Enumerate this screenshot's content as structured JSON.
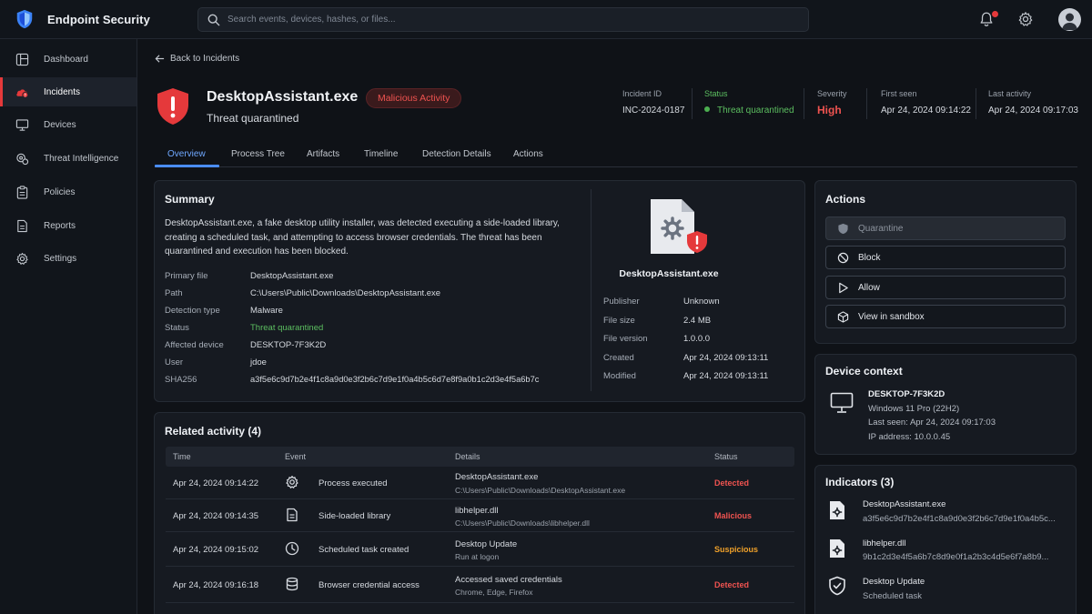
{
  "app": {
    "name": "Endpoint Security",
    "search_placeholder": "Search events, devices, hashes, or files..."
  },
  "sidebar": {
    "items": [
      {
        "label": "Dashboard",
        "icon": "dashboard-icon"
      },
      {
        "label": "Incidents",
        "icon": "incidents-icon",
        "active": true
      },
      {
        "label": "Devices",
        "icon": "monitor-icon"
      },
      {
        "label": "Threat Intelligence",
        "icon": "threat-intel-icon"
      },
      {
        "label": "Policies",
        "icon": "clipboard-icon"
      },
      {
        "label": "Reports",
        "icon": "report-icon"
      },
      {
        "label": "Settings",
        "icon": "gear-icon"
      }
    ]
  },
  "header": {
    "back_label": "Back to Incidents",
    "file_name": "DesktopAssistant.exe",
    "subtitle": "Threat quarantined",
    "badge": "Malicious Activity",
    "meta": {
      "incident_id_label": "Incident ID",
      "incident_id": "INC-2024-0187",
      "status_label": "Status",
      "status": "Threat quarantined",
      "severity_label": "Severity",
      "severity": "High",
      "first_seen_label": "First seen",
      "first_seen": "Apr 24, 2024 09:14:22",
      "last_activity_label": "Last activity",
      "last_activity": "Apr 24, 2024 09:17:03"
    }
  },
  "tabs": [
    "Overview",
    "Process Tree",
    "Artifacts",
    "Timeline",
    "Detection Details",
    "Actions"
  ],
  "summary": {
    "title": "Summary",
    "text": "DesktopAssistant.exe, a fake desktop utility installer, was detected executing a side-loaded library, creating a scheduled task, and attempting to access browser credentials. The threat has been quarantined and execution has been blocked.",
    "fields": [
      {
        "label": "Primary file",
        "value": "DesktopAssistant.exe"
      },
      {
        "label": "Path",
        "value": "C:\\Users\\Public\\Downloads\\DesktopAssistant.exe"
      },
      {
        "label": "Detection type",
        "value": "Malware"
      },
      {
        "label": "Status",
        "value": "Threat quarantined"
      },
      {
        "label": "Affected device",
        "value": "DESKTOP-7F3K2D"
      },
      {
        "label": "User",
        "value": "jdoe"
      },
      {
        "label": "SHA256",
        "value": "a3f5e6c9d7b2e4f1c8a9d0e3f2b6c7d9e1f0a4b5c6d7e8f9a0b1c2d3e4f5a6b7c"
      }
    ],
    "file_card": {
      "name": "DesktopAssistant.exe",
      "fields": [
        {
          "label": "Publisher",
          "value": "Unknown"
        },
        {
          "label": "File size",
          "value": "2.4 MB"
        },
        {
          "label": "File version",
          "value": "1.0.0.0"
        },
        {
          "label": "Created",
          "value": "Apr 24, 2024 09:13:11"
        },
        {
          "label": "Modified",
          "value": "Apr 24, 2024 09:13:11"
        }
      ]
    }
  },
  "related": {
    "title": "Related activity (4)",
    "columns": [
      "Time",
      "Event",
      "Details",
      "Status"
    ],
    "rows": [
      {
        "time": "Apr 24, 2024 09:14:22",
        "icon": "gear-icon",
        "event": "Process executed",
        "detail": "DesktopAssistant.exe",
        "detail_sub": "C:\\Users\\Public\\Downloads\\DesktopAssistant.exe",
        "status": "Detected",
        "status_color": "#ef5350"
      },
      {
        "time": "Apr 24, 2024 09:14:35",
        "icon": "document-icon",
        "event": "Side-loaded library",
        "detail": "libhelper.dll",
        "detail_sub": "C:\\Users\\Public\\Downloads\\libhelper.dll",
        "status": "Malicious",
        "status_color": "#ef5350"
      },
      {
        "time": "Apr 24, 2024 09:15:02",
        "icon": "clock-icon",
        "event": "Scheduled task created",
        "detail": "Desktop Update",
        "detail_sub": "Run at logon",
        "status": "Suspicious",
        "status_color": "#f0a12a"
      },
      {
        "time": "Apr 24, 2024 09:16:18",
        "icon": "database-icon",
        "event": "Browser credential access",
        "detail": "Accessed saved credentials",
        "detail_sub": "Chrome, Edge, Firefox",
        "status": "Detected",
        "status_color": "#ef5350"
      }
    ]
  },
  "actions": {
    "title": "Actions",
    "buttons": [
      {
        "label": "Quarantine",
        "icon": "shield-icon",
        "disabled": true
      },
      {
        "label": "Block",
        "icon": "block-icon"
      },
      {
        "label": "Allow",
        "icon": "play-icon"
      },
      {
        "label": "View in sandbox",
        "icon": "cube-icon"
      }
    ]
  },
  "device_context": {
    "title": "Device context",
    "name": "DESKTOP-7F3K2D",
    "os": "Windows 11 Pro (22H2)",
    "last_seen": "Last seen: Apr 24, 2024 09:17:03",
    "ip": "IP address: 10.0.0.45"
  },
  "indicators": {
    "title": "Indicators (3)",
    "items": [
      {
        "main": "DesktopAssistant.exe",
        "sub": "a3f5e6c9d7b2e4f1c8a9d0e3f2b6c7d9e1f0a4b5c...",
        "icon": "file-gear-icon"
      },
      {
        "main": "libhelper.dll",
        "sub": "9b1c2d3e4f5a6b7c8d9e0f1a2b3c4d5e6f7a8b9...",
        "icon": "file-gear-icon"
      },
      {
        "main": "Desktop Update",
        "sub": "Scheduled task",
        "icon": "shield-check-icon"
      }
    ]
  },
  "colors": {
    "accent": "#4a8df8",
    "danger": "#ef5350",
    "warning": "#f0a12a",
    "success": "#5cbf60"
  }
}
